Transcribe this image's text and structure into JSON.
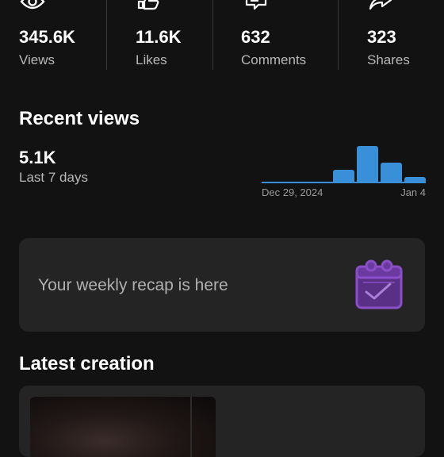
{
  "stats": [
    {
      "value": "345.6K",
      "label": "Views",
      "icon": "eye-icon"
    },
    {
      "value": "11.6K",
      "label": "Likes",
      "icon": "thumbs-up-icon"
    },
    {
      "value": "632",
      "label": "Comments",
      "icon": "comment-icon"
    },
    {
      "value": "323",
      "label": "Shares",
      "icon": "share-icon"
    }
  ],
  "recent_views": {
    "title": "Recent views",
    "value": "5.1K",
    "period": "Last 7 days",
    "chart_data": {
      "type": "bar",
      "start_label": "Dec 29, 2024",
      "end_label": "Jan 4",
      "values": [
        0,
        0,
        0,
        0.35,
        1.0,
        0.55,
        0.15
      ],
      "color": "#3a8fd9"
    }
  },
  "recap": {
    "text": "Your weekly recap is here",
    "icon": "calendar-check-icon",
    "accent": "#8a4fc7"
  },
  "latest_creation": {
    "title": "Latest creation"
  },
  "colors": {
    "background": "#121212",
    "card": "#242424",
    "secondary_text": "#b8b8b8",
    "bar": "#3a8fd9"
  }
}
